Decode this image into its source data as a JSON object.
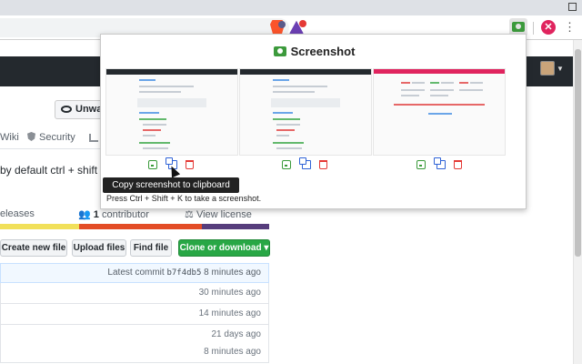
{
  "colors": {
    "accent_green": "#28a745",
    "github_dark": "#24292e",
    "copy_blue": "#2e62d6",
    "delete_red": "#e53935",
    "lang_bar": [
      "#f1e05a",
      "#e34c26",
      "#563d7c"
    ]
  },
  "page": {
    "repo_actions": {
      "unwatch_label": "Unwatch"
    },
    "tabs": {
      "wiki": "Wiki",
      "security": "Security"
    },
    "description": "by default ctrl + shift +",
    "stats": {
      "releases": "eleases",
      "contributors_count": "1",
      "contributors_label": "contributor",
      "license": "View license"
    },
    "buttons": {
      "new_file": "Create new file",
      "upload": "Upload files",
      "find": "Find file",
      "clone": "Clone or download ▾"
    },
    "commit": {
      "label": "Latest commit",
      "hash": "b7f4db5",
      "time": "8 minutes ago"
    },
    "file_times": [
      "30 minutes ago",
      "14 minutes ago",
      "21 days ago",
      "8 minutes ago"
    ]
  },
  "popup": {
    "title": "Screenshot",
    "tooltip": "Copy screenshot to clipboard",
    "hint": "Press Ctrl + Shift + K to take a screenshot.",
    "thumbnails": [
      {
        "name": "thumbnail-1"
      },
      {
        "name": "thumbnail-2"
      },
      {
        "name": "thumbnail-3"
      }
    ]
  },
  "icons": {
    "save": "save-icon",
    "copy": "copy-icon",
    "delete": "delete-icon"
  }
}
